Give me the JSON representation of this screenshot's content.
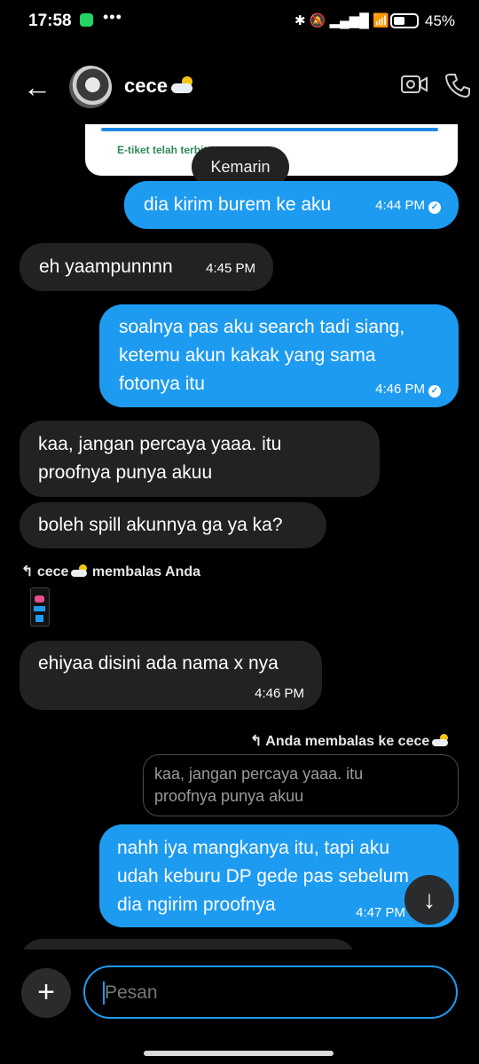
{
  "status_bar": {
    "time": "17:58",
    "dots": "•••",
    "icons": "✱ 🔕 ▂▄▆█ 📶",
    "battery_pct": "45%",
    "battery_level": 0.45
  },
  "header": {
    "contact_name": "cece"
  },
  "preview": {
    "text": "E-tiket telah terbit"
  },
  "date_pill": "Kemarin",
  "messages": [
    {
      "text": "dia kirim burem ke aku",
      "time": "4:44 PM"
    },
    {
      "text": "eh yaampunnnn",
      "time": "4:45 PM"
    },
    {
      "line1": "soalnya pas aku search tadi siang,",
      "line2": "ketemu akun kakak yang sama",
      "line3": "fotonya itu",
      "time": "4:46 PM"
    },
    {
      "line1": "kaa, jangan percaya yaaa. itu",
      "line2": "proofnya punya akuu"
    },
    {
      "text": "boleh spill akunnya ga ya ka?"
    },
    {
      "reply_header": "cece",
      "reply_suffix": "membalas Anda"
    },
    {
      "text": "ehiyaa disini ada nama x nya",
      "time": "4:46 PM"
    },
    {
      "reply_header": "Anda membalas ke cece",
      "quote_line1": "kaa, jangan percaya yaaa. itu",
      "quote_line2": "proofnya punya akuu"
    },
    {
      "line1": "nahh iya mangkanya itu, tapi aku",
      "line2": "udah keburu DP gede pas sebelum",
      "line3": "dia ngirim proofnya",
      "time": "4:47 PM"
    }
  ],
  "composer": {
    "placeholder": "Pesan"
  }
}
